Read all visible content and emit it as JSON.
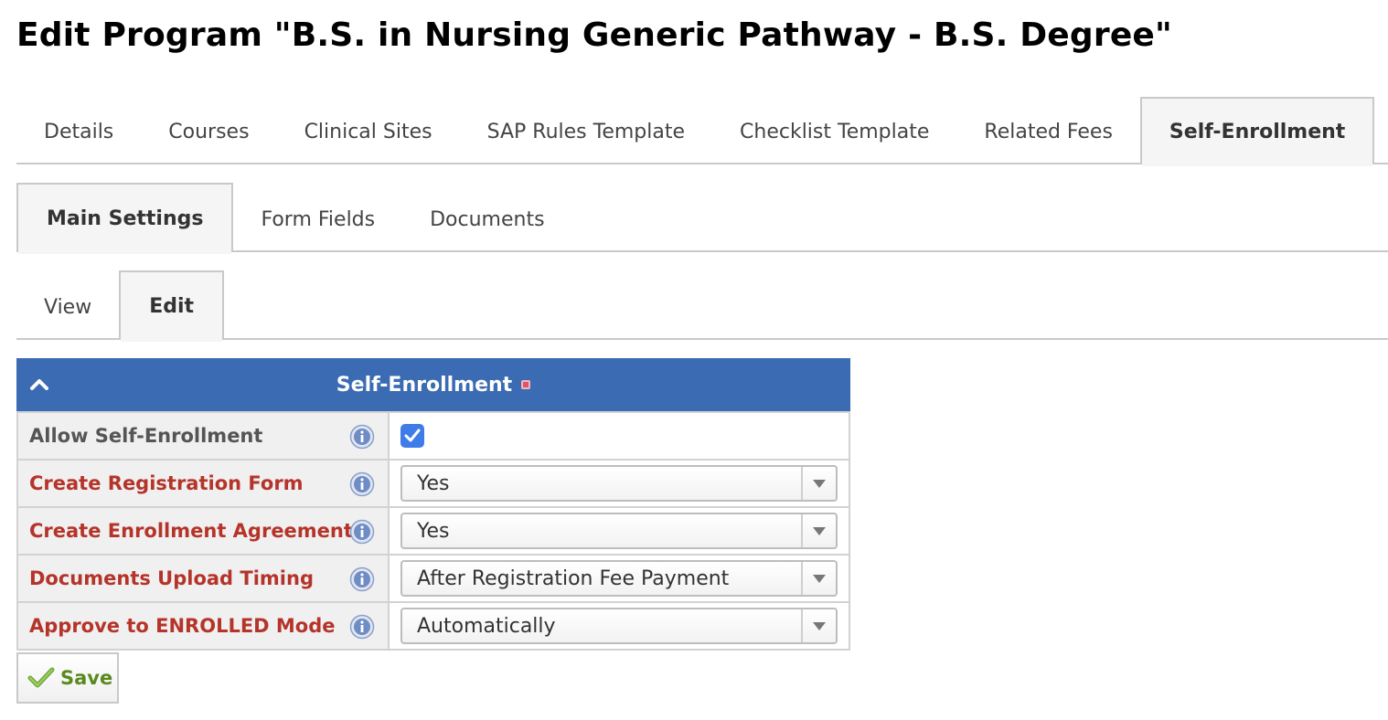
{
  "page": {
    "title": "Edit Program \"B.S. in Nursing Generic Pathway - B.S. Degree\""
  },
  "program_tabs": [
    {
      "label": "Details",
      "active": false
    },
    {
      "label": "Courses",
      "active": false
    },
    {
      "label": "Clinical Sites",
      "active": false
    },
    {
      "label": "SAP Rules Template",
      "active": false
    },
    {
      "label": "Checklist Template",
      "active": false
    },
    {
      "label": "Related Fees",
      "active": false
    },
    {
      "label": "Self-Enrollment",
      "active": true
    }
  ],
  "self_enrollment_tabs": [
    {
      "label": "Main Settings",
      "active": true
    },
    {
      "label": "Form Fields",
      "active": false
    },
    {
      "label": "Documents",
      "active": false
    }
  ],
  "mode_tabs": [
    {
      "label": "View",
      "active": false
    },
    {
      "label": "Edit",
      "active": true
    }
  ],
  "panel": {
    "title": "Self-Enrollment",
    "header_color": "#3b6bb2",
    "fields": [
      {
        "label": "Allow Self-Enrollment",
        "required": false,
        "type": "checkbox",
        "checked": true
      },
      {
        "label": "Create Registration Form",
        "required": true,
        "type": "select",
        "value": "Yes"
      },
      {
        "label": "Create Enrollment Agreement",
        "required": true,
        "type": "select",
        "value": "Yes"
      },
      {
        "label": "Documents Upload Timing",
        "required": true,
        "type": "select",
        "value": "After Registration Fee Payment"
      },
      {
        "label": "Approve to ENROLLED Mode",
        "required": true,
        "type": "select",
        "value": "Automatically"
      }
    ]
  },
  "actions": {
    "save_label": "Save"
  },
  "colors": {
    "required_label": "#b5342a",
    "save_green": "#5a8a1e",
    "checkbox_blue": "#3f7ce8"
  }
}
